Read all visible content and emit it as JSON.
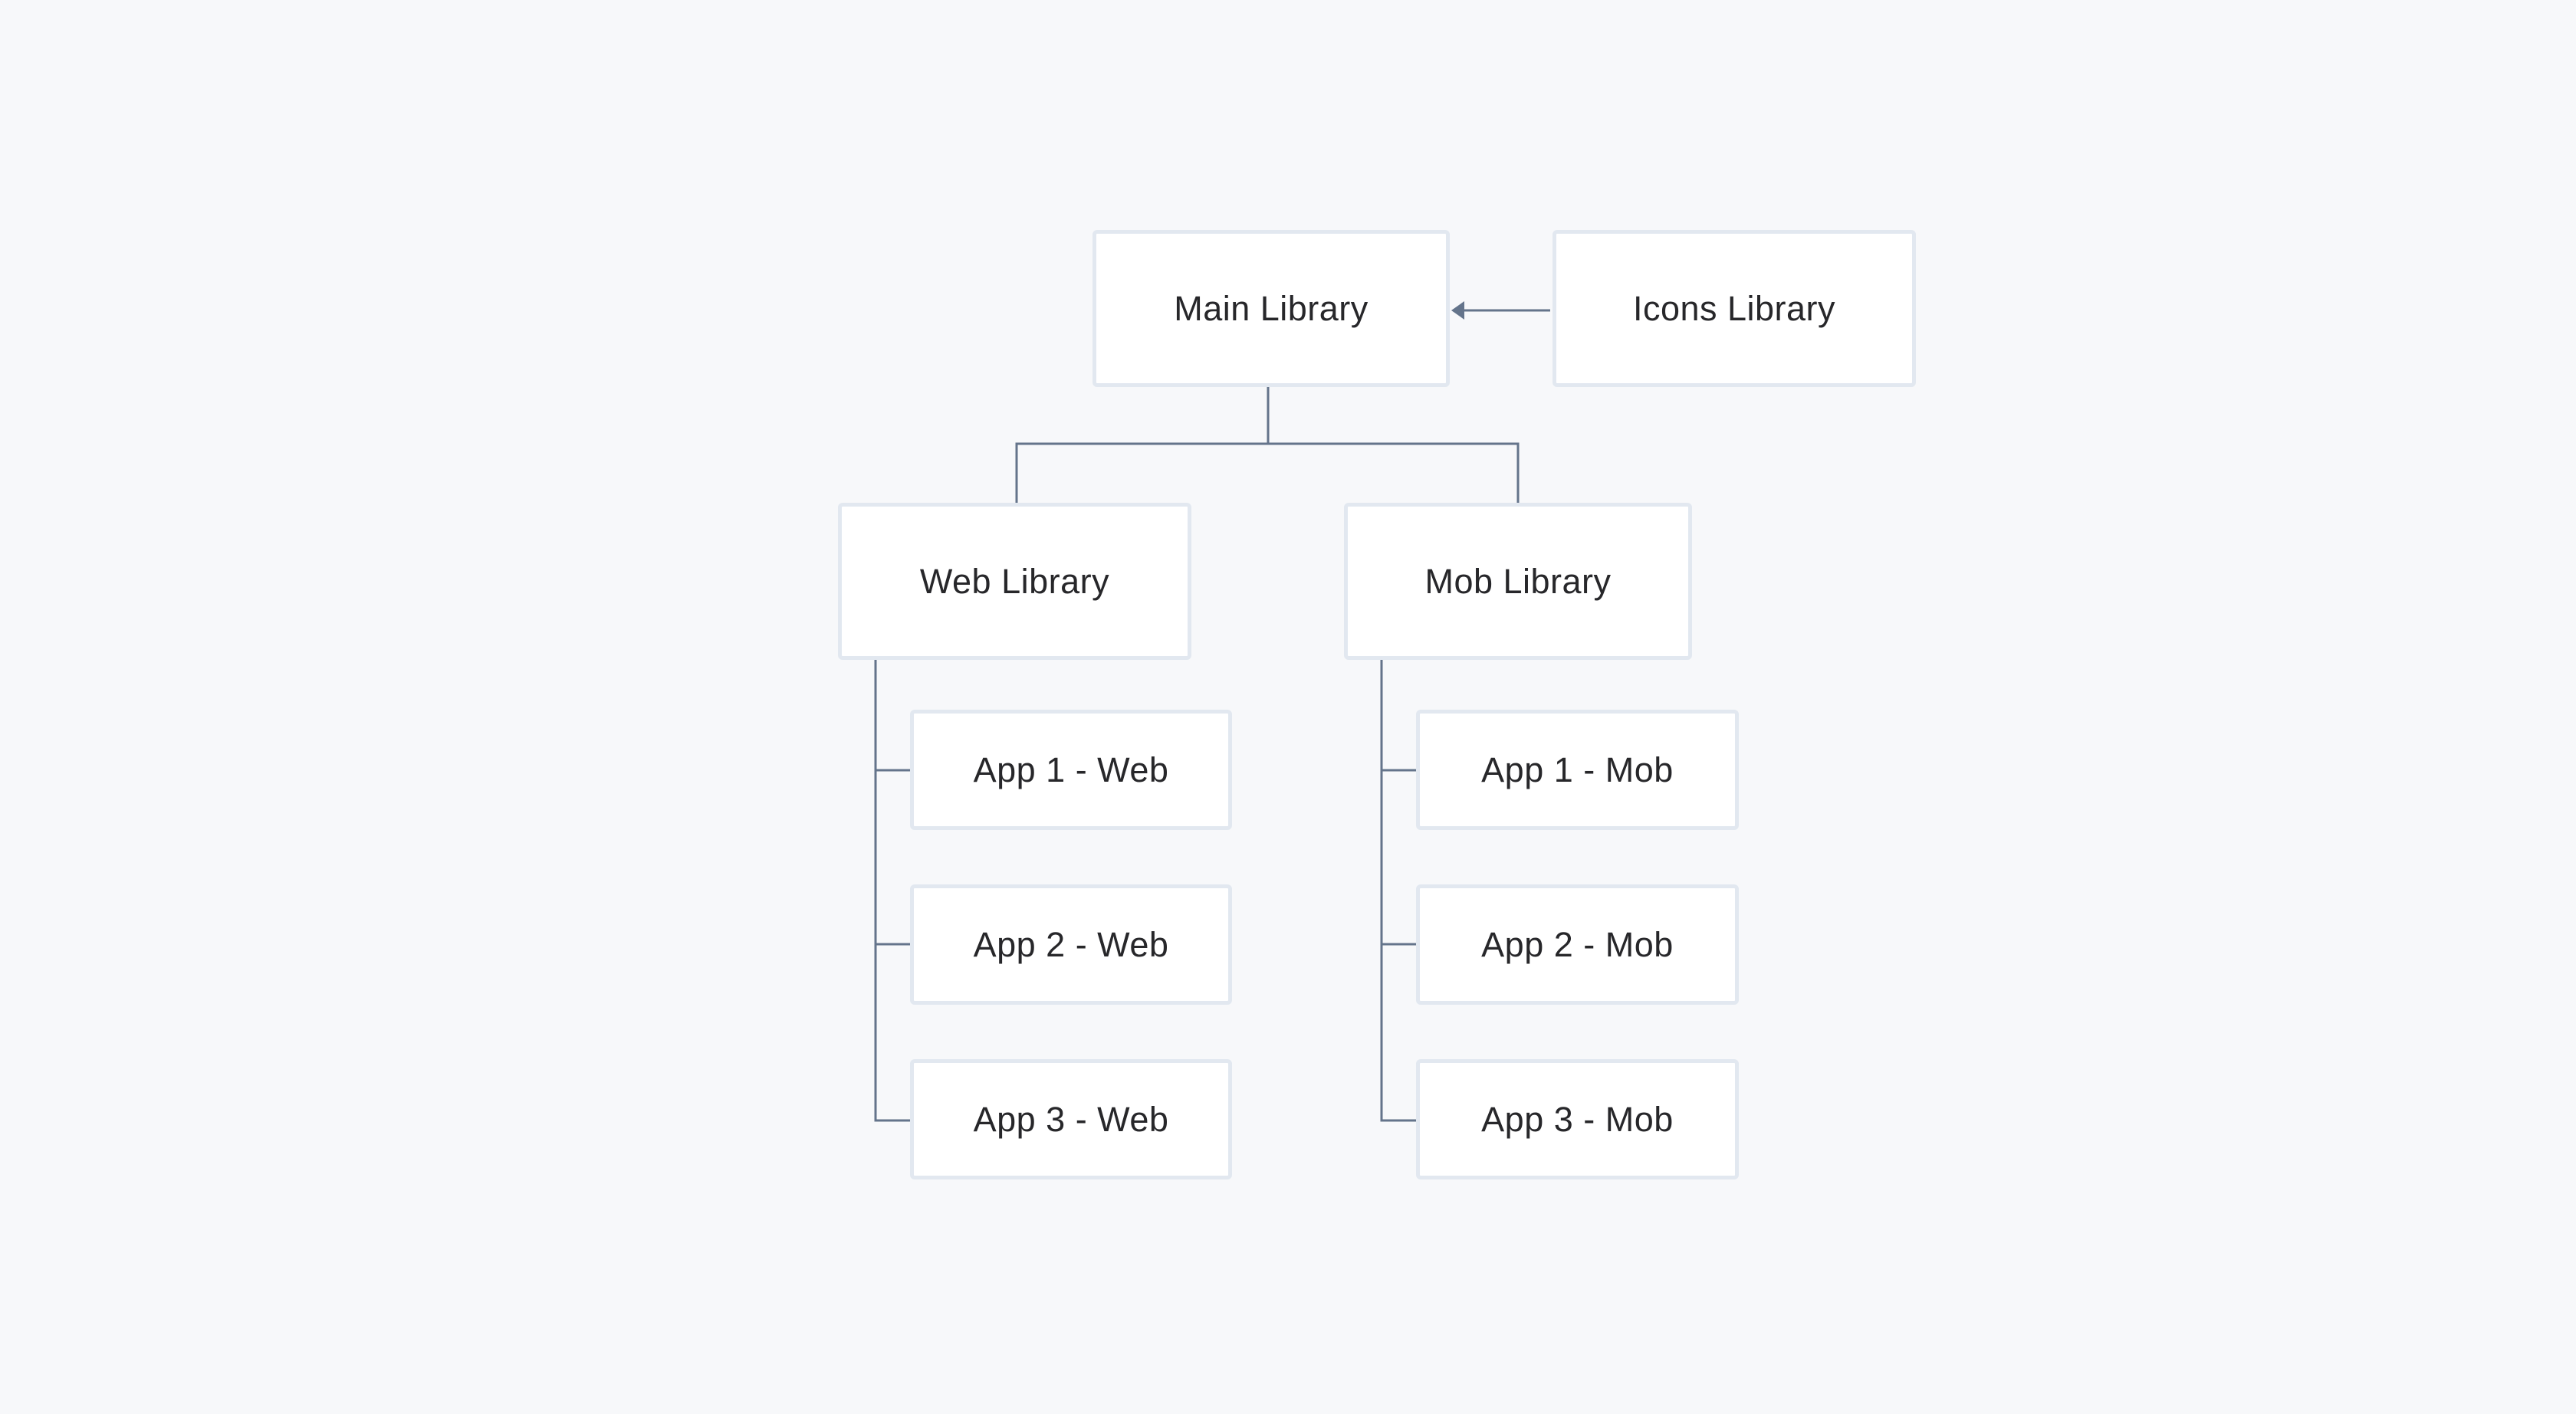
{
  "diagram": {
    "colors": {
      "connector": "#64748b",
      "node_border": "#e2e8f0",
      "node_fill": "#ffffff",
      "background": "#f7f8fa"
    },
    "nodes": {
      "main": "Main Library",
      "icons": "Icons Library",
      "web": "Web Library",
      "mob": "Mob Library",
      "web_apps": [
        "App 1 - Web",
        "App 2 - Web",
        "App 3 - Web"
      ],
      "mob_apps": [
        "App 1 - Mob",
        "App 2 - Mob",
        "App 3 - Mob"
      ]
    },
    "edges": [
      {
        "from": "Icons Library",
        "to": "Main Library",
        "arrow": true
      },
      {
        "from": "Main Library",
        "to": "Web Library"
      },
      {
        "from": "Main Library",
        "to": "Mob Library"
      },
      {
        "from": "Web Library",
        "to": "App 1 - Web"
      },
      {
        "from": "Web Library",
        "to": "App 2 - Web"
      },
      {
        "from": "Web Library",
        "to": "App 3 - Web"
      },
      {
        "from": "Mob Library",
        "to": "App 1 - Mob"
      },
      {
        "from": "Mob Library",
        "to": "App 2 - Mob"
      },
      {
        "from": "Mob Library",
        "to": "App 3 - Mob"
      }
    ]
  }
}
